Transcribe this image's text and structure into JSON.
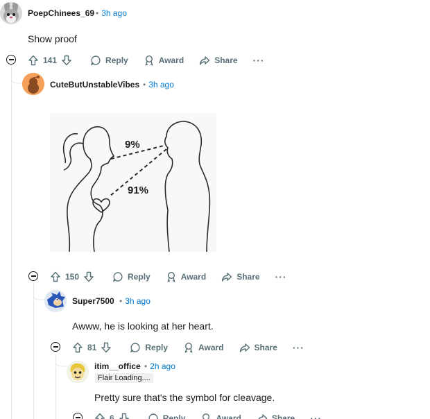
{
  "comments": [
    {
      "username": "PoepChinees_69",
      "time": "3h ago",
      "body": "Show proof",
      "score": "141",
      "reply": "Reply",
      "award": "Award",
      "share": "Share",
      "more": "···"
    },
    {
      "username": "CuteButUnstableVibes",
      "time": "3h ago",
      "image_labels": {
        "top": "9%",
        "bottom": "91%"
      },
      "score": "150",
      "reply": "Reply",
      "award": "Award",
      "share": "Share",
      "more": "···"
    },
    {
      "username": "Super7500",
      "time": "3h ago",
      "body": "Awww, he is looking at her heart.",
      "score": "81",
      "reply": "Reply",
      "award": "Award",
      "share": "Share",
      "more": "···"
    },
    {
      "username": "itim__office",
      "time": "2h ago",
      "flair": "Flair Loading....",
      "body": "Pretty sure that's the symbol for cleavage.",
      "score": "6",
      "reply": "Reply",
      "award": "Award",
      "share": "Share",
      "more": "···"
    }
  ],
  "colors": {
    "meta_time": "#0079d3",
    "action_text": "#576f76",
    "thread_line": "#e0e6ea"
  },
  "icons": [
    "upvote-icon",
    "downvote-icon",
    "reply-icon",
    "award-icon",
    "share-icon",
    "collapse-icon"
  ]
}
